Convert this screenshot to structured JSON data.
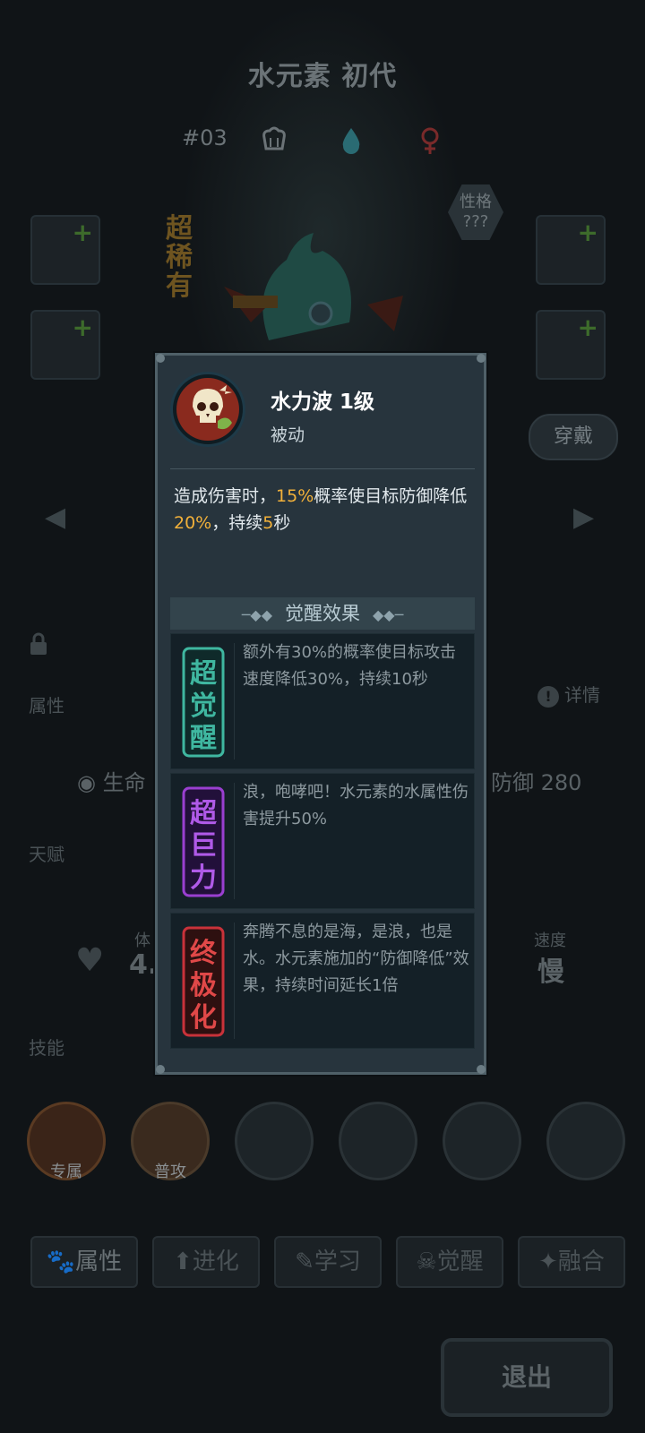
{
  "background": {
    "monster_name": "水元素 初代",
    "number": "#03",
    "meta_icons": [
      "chef-hat-icon",
      "water-drop-icon",
      "female-icon"
    ],
    "rarity": "超稀有",
    "personality": {
      "line1": "性格",
      "line2": "???"
    },
    "wear_button": "穿戴",
    "detail_link": "详情",
    "sections": {
      "attributes": "属性",
      "talent": "天赋",
      "skills": "技能"
    },
    "stats": {
      "hp_label": "生命",
      "defense": "防御 280",
      "stamina_label": "体",
      "stamina_value": "4.",
      "speed_label": "速度",
      "speed_value": "慢"
    },
    "skill_slots": [
      {
        "caption": "专属",
        "state": "owned"
      },
      {
        "caption": "普攻",
        "state": "basic"
      },
      {
        "caption": "",
        "state": "locked"
      },
      {
        "caption": "",
        "state": "locked"
      },
      {
        "caption": "",
        "state": "locked"
      },
      {
        "caption": "",
        "state": "locked"
      }
    ],
    "tabs": [
      "属性",
      "进化",
      "学习",
      "觉醒",
      "融合"
    ],
    "exit_button": "退出"
  },
  "modal": {
    "skill_name": "水力波 1级",
    "skill_type": "被动",
    "description_parts": {
      "p1": "造成伤害时，",
      "h1": "15%",
      "p2": "概率使目标防御降低",
      "h2": "20%",
      "p3": "，持续",
      "h3": "5",
      "p4": "秒"
    },
    "awakening_header": "觉醒效果",
    "awakenings": [
      {
        "badge": "超觉醒",
        "text": "额外有30%的概率使目标攻击速度降低30%，持续10秒"
      },
      {
        "badge": "超巨力",
        "text": "浪，咆哮吧！水元素的水属性伤害提升50%"
      },
      {
        "badge": "终极化",
        "text": "奔腾不息的是海，是浪，也是水。水元素施加的“防御降低”效果，持续时间延长1倍"
      }
    ]
  },
  "colors": {
    "highlight": "#f2b13a",
    "modal_bg": "#27343d",
    "badge_awaken": "#3fb7a0",
    "badge_power": "#9a3fd0",
    "badge_ultimate": "#c8323a"
  }
}
